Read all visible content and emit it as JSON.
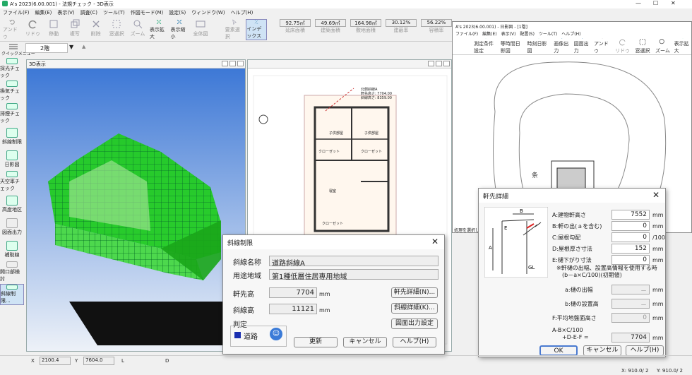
{
  "app": {
    "title": "A's 2023(6.00.001) - 法規チェック - 3D表示",
    "window_controls": [
      "—",
      "☐",
      "✕"
    ]
  },
  "menu": [
    "ファイル(F)",
    "編集(E)",
    "表示(V)",
    "調査(C)",
    "ツール(T)",
    "作図モード(M)",
    "設定(S)",
    "ウィンドウ(W)",
    "ヘルプ(H)"
  ],
  "toolbar": {
    "buttons": [
      "アンドゥ",
      "リドゥ",
      "移動",
      "複写",
      "削除",
      "窓選択",
      "ズーム",
      "表示拡大",
      "表示縮小",
      "全体図",
      "要素選択",
      "インデックス"
    ],
    "stats": [
      {
        "value": "92.75㎡",
        "label": "延床面積"
      },
      {
        "value": "49.69㎡",
        "label": "建築面積"
      },
      {
        "value": "164.98㎡",
        "label": "敷地面積"
      },
      {
        "value": "30.12%",
        "label": "建蔽率"
      },
      {
        "value": "56.22%",
        "label": "容積率"
      }
    ]
  },
  "quick": {
    "label": "クイックメニュー",
    "floor": "2階"
  },
  "sidebar": [
    "採光チェック",
    "換気チェック",
    "排煙チェック",
    "斜線制限",
    "日影図",
    "天空率チェック",
    "高度地区",
    "図面出力",
    "補助線",
    "開口部検討",
    "斜線制限..."
  ],
  "view3d": {
    "title": "3D表示"
  },
  "plan": {
    "north_label": "北側斜線A",
    "north_line1": "軒先高さ: 7704.00",
    "north_line2": "斜線高さ: 8359.00",
    "rooms": [
      "子供部屋",
      "子供部屋",
      "クローゼット",
      "クローゼット",
      "寝室",
      "クローゼット"
    ]
  },
  "shadow_win": {
    "title": "A's 2023(6.00.001) - 日影図 - [1階]",
    "menu": [
      "ファイル(F)",
      "編集(E)",
      "表示(V)",
      "配置(S)",
      "ツール(T)",
      "ヘルプ(H)"
    ],
    "tools": [
      "測定条件設定",
      "等時間日影図",
      "時刻日影図",
      "画像出力",
      "図面出力",
      "アンドゥ",
      "リドゥ",
      "窓選択",
      "ズーム",
      "表示拡大"
    ],
    "south": "条",
    "note": "処理を選択して"
  },
  "slope_dialog": {
    "title": "斜線制限",
    "name_label": "斜線名称",
    "name_value": "道路斜線A",
    "zone_label": "用途地域",
    "zone_value": "第1種低層住居専用地域",
    "eave_label": "軒先高",
    "eave_value": "7704",
    "line_label": "斜線高",
    "line_value": "11121",
    "unit": "mm",
    "judge_label": "判定",
    "judge_value": "道路",
    "btn_eave": "軒先詳細(N)...",
    "btn_line": "斜線詳細(K)...",
    "btn_out": "図面出力設定",
    "btn_update": "更新",
    "btn_cancel": "キャンセル",
    "btn_help": "ヘルプ(H)"
  },
  "eave_dialog": {
    "title": "軒先詳細",
    "rows": [
      {
        "label": "A:建物軒高さ",
        "value": "7552",
        "unit": "mm"
      },
      {
        "label": "B:軒の出(ａを含む)",
        "value": "0",
        "unit": "mm"
      },
      {
        "label": "C:屋根勾配",
        "value": "0",
        "unit": "/100"
      },
      {
        "label": "D:屋根厚さ寸法",
        "value": "152",
        "unit": "mm"
      },
      {
        "label": "E:樋下がり寸法",
        "value": "0",
        "unit": "mm"
      }
    ],
    "note1": "※軒樋の出幅、設置高情報を使用する時",
    "note2": "(b－a×C/100)(初期値)",
    "sub_rows": [
      {
        "label": "a:樋の出幅",
        "value": "－",
        "unit": "mm"
      },
      {
        "label": "b:樋の設置高",
        "value": "－",
        "unit": "mm"
      },
      {
        "label": "F:平均地盤面高さ",
        "value": "0",
        "unit": "mm"
      }
    ],
    "formula1": "A-B×C/100",
    "formula2": "+D-E-F =",
    "result": "7704",
    "result_unit": "mm",
    "ok": "OK",
    "cancel": "キャンセル",
    "help": "ヘルプ(H)"
  },
  "status": {
    "x_label": "X",
    "x_value": "2100.4",
    "y_label": "Y",
    "y_value": "7604.0",
    "l_label": "L",
    "d_label": "D",
    "right1": "X: 910.0/ 2",
    "right2": "Y: 910.0/ 2"
  }
}
